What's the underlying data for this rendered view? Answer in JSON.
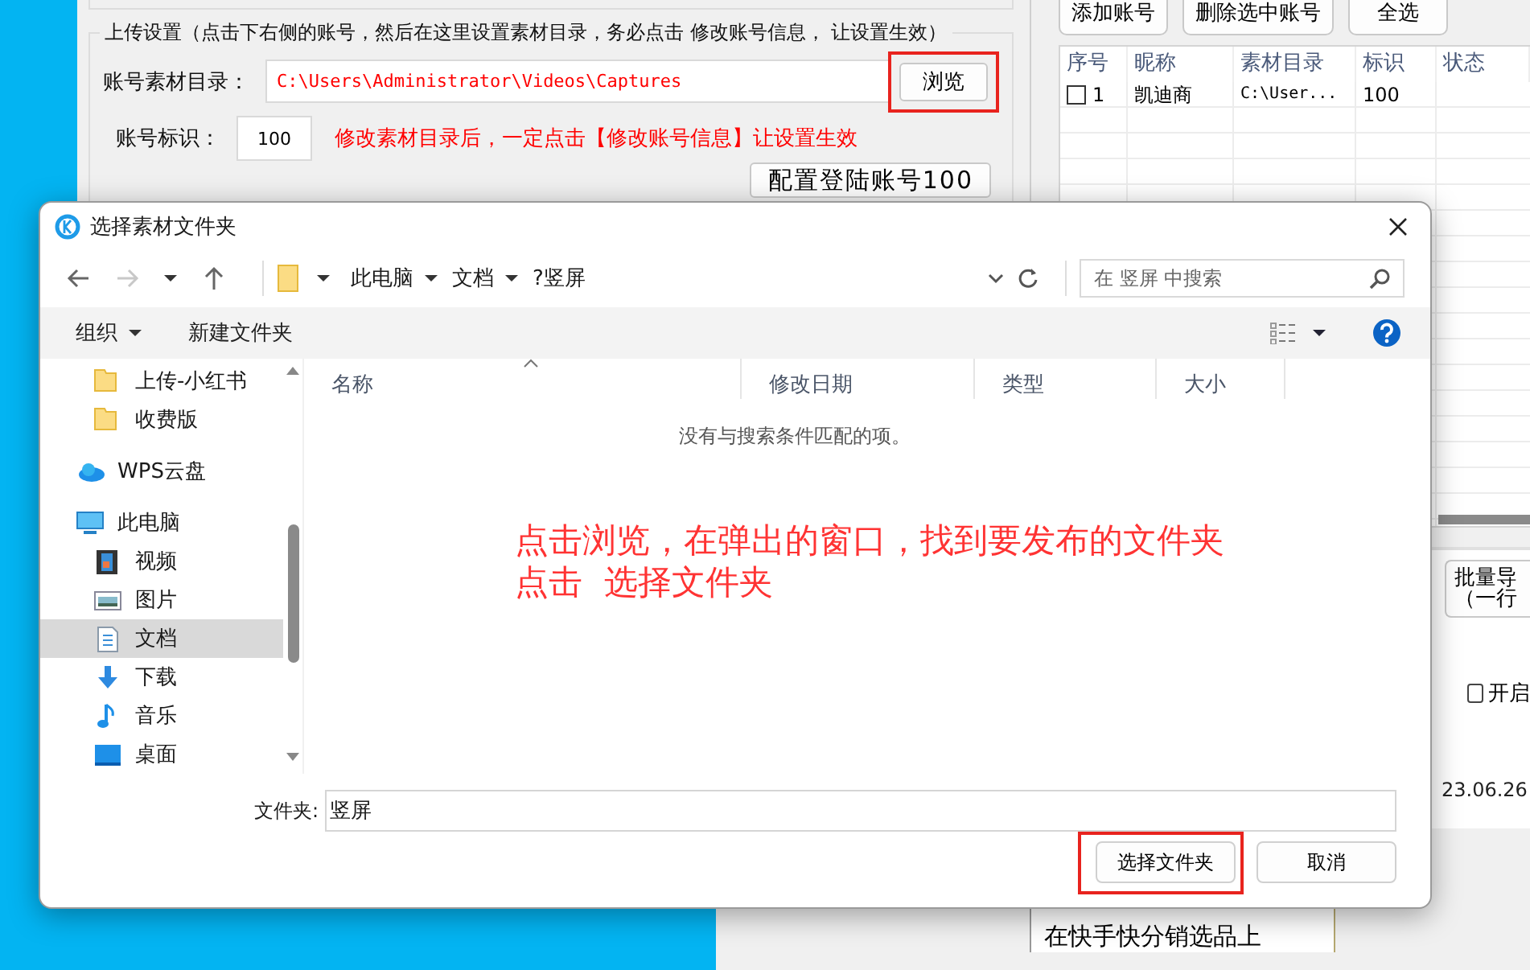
{
  "settings": {
    "group_title": "上传设置（点击下右侧的账号，然后在这里设置素材目录，务必点击 修改账号信息， 让设置生效）",
    "folder_label": "账号素材目录：",
    "folder_value": "C:\\Users\\Administrator\\Videos\\Captures",
    "browse_button": {
      "label": "浏览",
      "highlighted": true
    },
    "id_label": "账号标识：",
    "id_value": "100",
    "hint": "修改素材目录后，一定点击【修改账号信息】让设置生效",
    "config_button": "配置登陆账号100"
  },
  "accounts": {
    "buttons": [
      "添加账号",
      "删除选中账号",
      "全选"
    ],
    "columns": [
      "序号",
      "昵称",
      "素材目录",
      "标识",
      "状态"
    ],
    "rows": [
      {
        "checked": false,
        "index": "1",
        "nickname": "凯迪商",
        "folder": "C:\\User...",
        "tag": "100"
      }
    ]
  },
  "side": {
    "import_button": [
      "批量导",
      "（一行"
    ],
    "checkbox": {
      "label": "开启",
      "checked": false
    },
    "date": "23.06.26"
  },
  "log": {
    "text": "在快手快分销选品上"
  },
  "dialog": {
    "title": "选择素材文件夹",
    "breadcrumbs": [
      "此电脑",
      "文档",
      "?竖屏"
    ],
    "search": {
      "placeholder": "在 竖屏 中搜索"
    },
    "toolbar": {
      "organize": "组织",
      "new_folder": "新建文件夹"
    },
    "nav_items": [
      {
        "label": "上传-小红书",
        "kind": "folder",
        "selected": false
      },
      {
        "label": "收费版",
        "kind": "folder",
        "selected": false
      },
      {
        "label": "WPS云盘",
        "kind": "cloud",
        "selected": false
      },
      {
        "label": "此电脑",
        "kind": "pc",
        "selected": false,
        "children": [
          {
            "label": "视频",
            "kind": "video",
            "selected": false
          },
          {
            "label": "图片",
            "kind": "picture",
            "selected": false
          },
          {
            "label": "文档",
            "kind": "document",
            "selected": true
          },
          {
            "label": "下载",
            "kind": "download",
            "selected": false
          },
          {
            "label": "音乐",
            "kind": "music",
            "selected": false
          },
          {
            "label": "桌面",
            "kind": "desktop",
            "selected": false
          }
        ]
      }
    ],
    "columns": [
      "名称",
      "修改日期",
      "类型",
      "大小"
    ],
    "empty_message": "没有与搜索条件匹配的项。",
    "annotation": [
      "点击浏览，在弹出的窗口，找到要发布的文件夹",
      "点击  选择文件夹"
    ],
    "folder_label": "文件夹:",
    "folder_value": "竖屏",
    "buttons": [
      {
        "label": "选择文件夹",
        "highlighted": true
      },
      {
        "label": "取消",
        "highlighted": false
      }
    ]
  }
}
